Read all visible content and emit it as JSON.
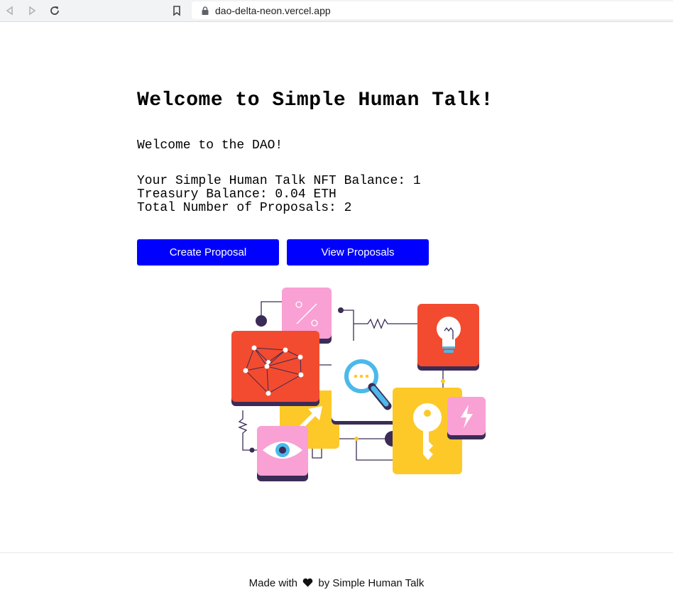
{
  "browser": {
    "url": "dao-delta-neon.vercel.app"
  },
  "main": {
    "title": "Welcome to Simple Human Talk!",
    "welcome": "Welcome to the DAO!",
    "nft_balance": "Your Simple Human Talk NFT Balance: 1",
    "treasury_balance": "Treasury Balance: 0.04 ETH",
    "total_proposals": "Total Number of Proposals: 2",
    "create_button": "Create Proposal",
    "view_button": "View Proposals"
  },
  "footer": {
    "prefix": "Made with",
    "suffix": "by Simple Human Talk"
  },
  "colors": {
    "accent": "#0000ff",
    "illustration_red": "#f24b2f",
    "illustration_pink": "#f9a0d4",
    "illustration_yellow": "#fdc929",
    "illustration_blue": "#4bb9ea",
    "illustration_dark": "#3a2c56"
  }
}
